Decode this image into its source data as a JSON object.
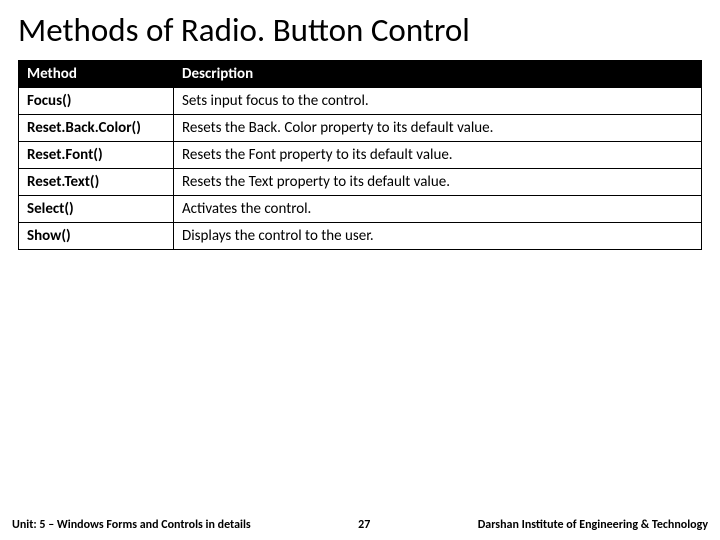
{
  "title": "Methods of Radio. Button Control",
  "headers": {
    "method": "Method",
    "description": "Description"
  },
  "rows": [
    {
      "method": "Focus()",
      "description": "Sets input focus to the control."
    },
    {
      "method": "Reset.Back.Color()",
      "description": "Resets the Back. Color property to its default value."
    },
    {
      "method": "Reset.Font()",
      "description": "Resets the Font property to its default value."
    },
    {
      "method": "Reset.Text()",
      "description": "Resets the Text property to its default value."
    },
    {
      "method": "Select()",
      "description": "Activates the control."
    },
    {
      "method": "Show()",
      "description": "Displays the control to the user."
    }
  ],
  "footer": {
    "unit": "Unit: 5 – Windows Forms and Controls in details",
    "page": "27",
    "institute": "Darshan Institute of Engineering & Technology"
  }
}
